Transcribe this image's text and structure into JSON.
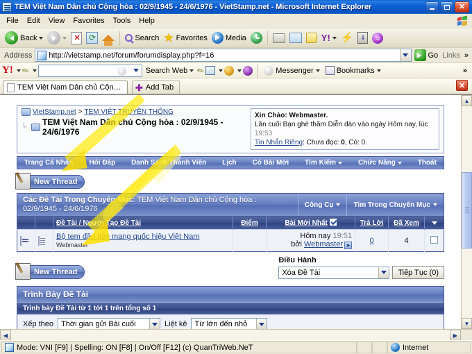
{
  "window": {
    "title": "TEM Việt Nam Dân chủ Cộng hòa : 02/9/1945 - 24/6/1976 - VietStamp.net - Microsoft Internet Explorer",
    "icon": "ie-page-icon",
    "minimize_label": "Minimize",
    "restore_label": "Restore",
    "close_label": "Close"
  },
  "menu": {
    "items": [
      {
        "label": "File"
      },
      {
        "label": "Edit"
      },
      {
        "label": "View"
      },
      {
        "label": "Favorites"
      },
      {
        "label": "Tools"
      },
      {
        "label": "Help"
      }
    ],
    "brand_icon": "windows-flag-icon"
  },
  "toolbar": {
    "back_label": "Back",
    "forward_label": "Forward",
    "stop_label": "Stop",
    "refresh_label": "Refresh",
    "home_label": "Home",
    "search_label": "Search",
    "favorites_label": "Favorites",
    "media_label": "Media",
    "history_label": "History",
    "print_label": "Print",
    "edit_label": "Edit",
    "folder_label": "Folder",
    "yahoo_label": "Yahoo!",
    "messenger_label": "Messenger",
    "download_label": "Download",
    "smiley_label": "Smiley"
  },
  "address": {
    "label": "Address",
    "url": "http://vietstamp.net/forum/forumdisplay.php?f=16",
    "go_label": "Go",
    "links_label": "Links",
    "overflow_label": "»"
  },
  "yahoo_toolbar": {
    "logo": "Y!",
    "search_value": "",
    "search_web_label": "Search Web",
    "messenger_label": "Messenger",
    "bookmarks_label": "Bookmarks",
    "overflow_label": "»"
  },
  "tabs": {
    "items": [
      {
        "label": "TEM Việt Nam Dân chủ Cộng hò…",
        "icon": "page-icon"
      }
    ],
    "add_tab_label": "Add Tab",
    "close_tab_label": "✕"
  },
  "forum": {
    "breadcrumb": {
      "root": "VietStamp.net",
      "separator": ">",
      "section": "TEM VIỆT TRUYỀN THỐNG",
      "current": "TEM Việt Nam Dân chủ Cộng hòa : 02/9/1945 - 24/6/1976"
    },
    "greeting": {
      "hello": "Xin Chào: Webmaster.",
      "lastvisit_pre": "Lần cuối Bạn ghé thăm Diễn đàn vào ngày Hôm nay, lúc",
      "lastvisit_time": "19:53",
      "pm_link": "Tin Nhắn Riêng",
      "pm_unread_label": ": Chưa đọc:",
      "pm_unread": "0",
      "pm_total_label": ", Có:",
      "pm_total": "0."
    },
    "nav": [
      {
        "label": "Trang Cá Nhân",
        "has_caret": false
      },
      {
        "label": "Hỏi Đáp",
        "has_caret": false
      },
      {
        "label": "Danh Sách Thành Viên",
        "has_caret": false
      },
      {
        "label": "Lịch",
        "has_caret": false
      },
      {
        "label": "Có Bài Mới",
        "has_caret": false
      },
      {
        "label": "Tìm Kiếm",
        "has_caret": true
      },
      {
        "label": "Chức Năng",
        "has_caret": true
      },
      {
        "label": "Thoát",
        "has_caret": false
      }
    ],
    "new_thread_label": "New Thread",
    "section": {
      "title_bold": "Các Đề Tài Trong Chuyên Mục",
      "title_rest": ": TEM Việt Nam Dân chủ Cộng hòa : 02/9/1945 - 24/6/1976",
      "tools_label": "Công Cụ",
      "search_label": "Tìm Trong Chuyên Mục"
    },
    "table": {
      "columns": {
        "thread": "Đề Tài / Người Tạo Đề Tài",
        "rating": "Điểm",
        "lastpost": "Bài Mới Nhất",
        "replies": "Trả Lời",
        "views": "Đã Xem"
      },
      "rows": [
        {
          "title": "Bộ tem đầu tiên mang quốc hiệu Việt Nam",
          "author": "Webmaster",
          "lastpost_day": "Hôm nay",
          "lastpost_time": "19:51",
          "lastpost_by_label": "bởi",
          "lastpost_by": "Webmaster",
          "replies": "0",
          "views": "4"
        }
      ]
    },
    "moderation": {
      "label": "Điều Hành",
      "selected": "Xóa Đề Tài",
      "button": "Tiếp Tục (0)"
    },
    "display": {
      "heading": "Trình Bày Đề Tài",
      "subheading": "Trình bày Đề Tài từ 1 tới 1 trên tổng số 1",
      "sortby_label": "Xếp theo",
      "sortby_value": "Thời gian gửi Bài cuối",
      "order_label": "Liệt kê",
      "order_value": "Từ lớn đến nhỏ"
    }
  },
  "statusbar": {
    "message": "Mode: VNI [F9] | Spelling: ON [F8] | On/Off [F12] (c) QuanTriWeb.NeT",
    "zone": "Internet"
  }
}
